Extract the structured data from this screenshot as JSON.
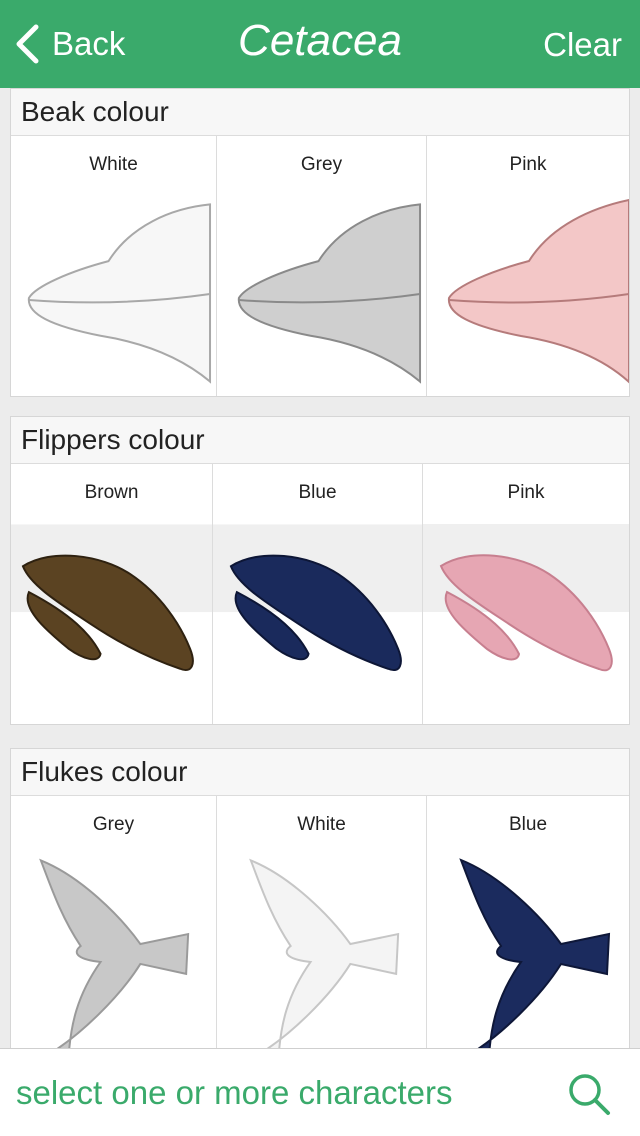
{
  "nav": {
    "back_label": "Back",
    "title": "Cetacea",
    "clear_label": "Clear"
  },
  "sections": [
    {
      "title": "Beak colour",
      "options": [
        {
          "label": "White",
          "fill": "#f7f7f7",
          "stroke": "#a8a8a8"
        },
        {
          "label": "Grey",
          "fill": "#cfcfcf",
          "stroke": "#8a8a8a"
        },
        {
          "label": "Pink",
          "fill": "#f3c7c7",
          "stroke": "#b57b7b"
        }
      ]
    },
    {
      "title": "Flippers colour",
      "options": [
        {
          "label": "Brown",
          "fill": "#5b4322",
          "stroke": "#2e2110"
        },
        {
          "label": "Blue",
          "fill": "#1a2a5c",
          "stroke": "#0d1636"
        },
        {
          "label": "Pink",
          "fill": "#e6a6b3",
          "stroke": "#c77f8f"
        }
      ]
    },
    {
      "title": "Flukes colour",
      "options": [
        {
          "label": "Grey",
          "fill": "#c8c8c8",
          "stroke": "#9a9a9a"
        },
        {
          "label": "White",
          "fill": "#f4f4f4",
          "stroke": "#c6c6c6"
        },
        {
          "label": "Blue",
          "fill": "#1b2b5e",
          "stroke": "#0e1738"
        }
      ]
    }
  ],
  "search": {
    "placeholder": "select one or more characters"
  },
  "colors": {
    "accent": "#3aaa6b"
  }
}
